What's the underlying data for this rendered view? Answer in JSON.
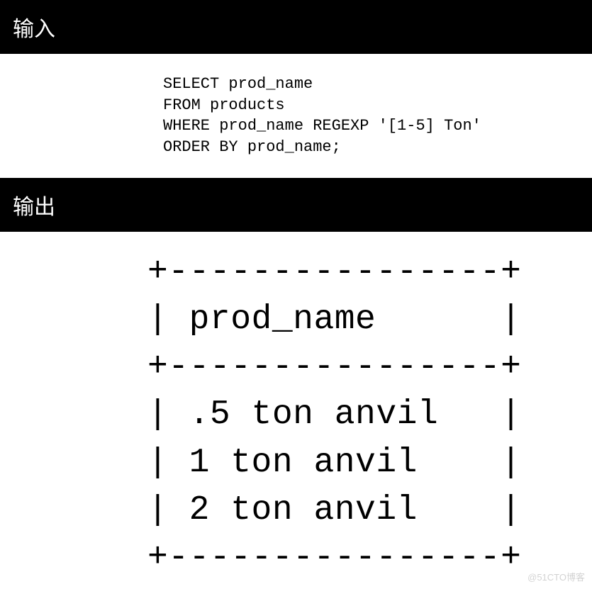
{
  "headers": {
    "input": "输入",
    "output": "输出"
  },
  "sql": {
    "line1": "SELECT prod_name",
    "line2": "FROM products",
    "line3": "WHERE prod_name REGEXP '[1-5] Ton'",
    "line4": "ORDER BY prod_name;"
  },
  "result": {
    "border": "+----------------+",
    "header": "| prod_name      |",
    "rows": {
      "r1": "| .5 ton anvil   |",
      "r2": "| 1 ton anvil    |",
      "r3": "| 2 ton anvil    |"
    }
  },
  "watermark": "@51CTO博客"
}
